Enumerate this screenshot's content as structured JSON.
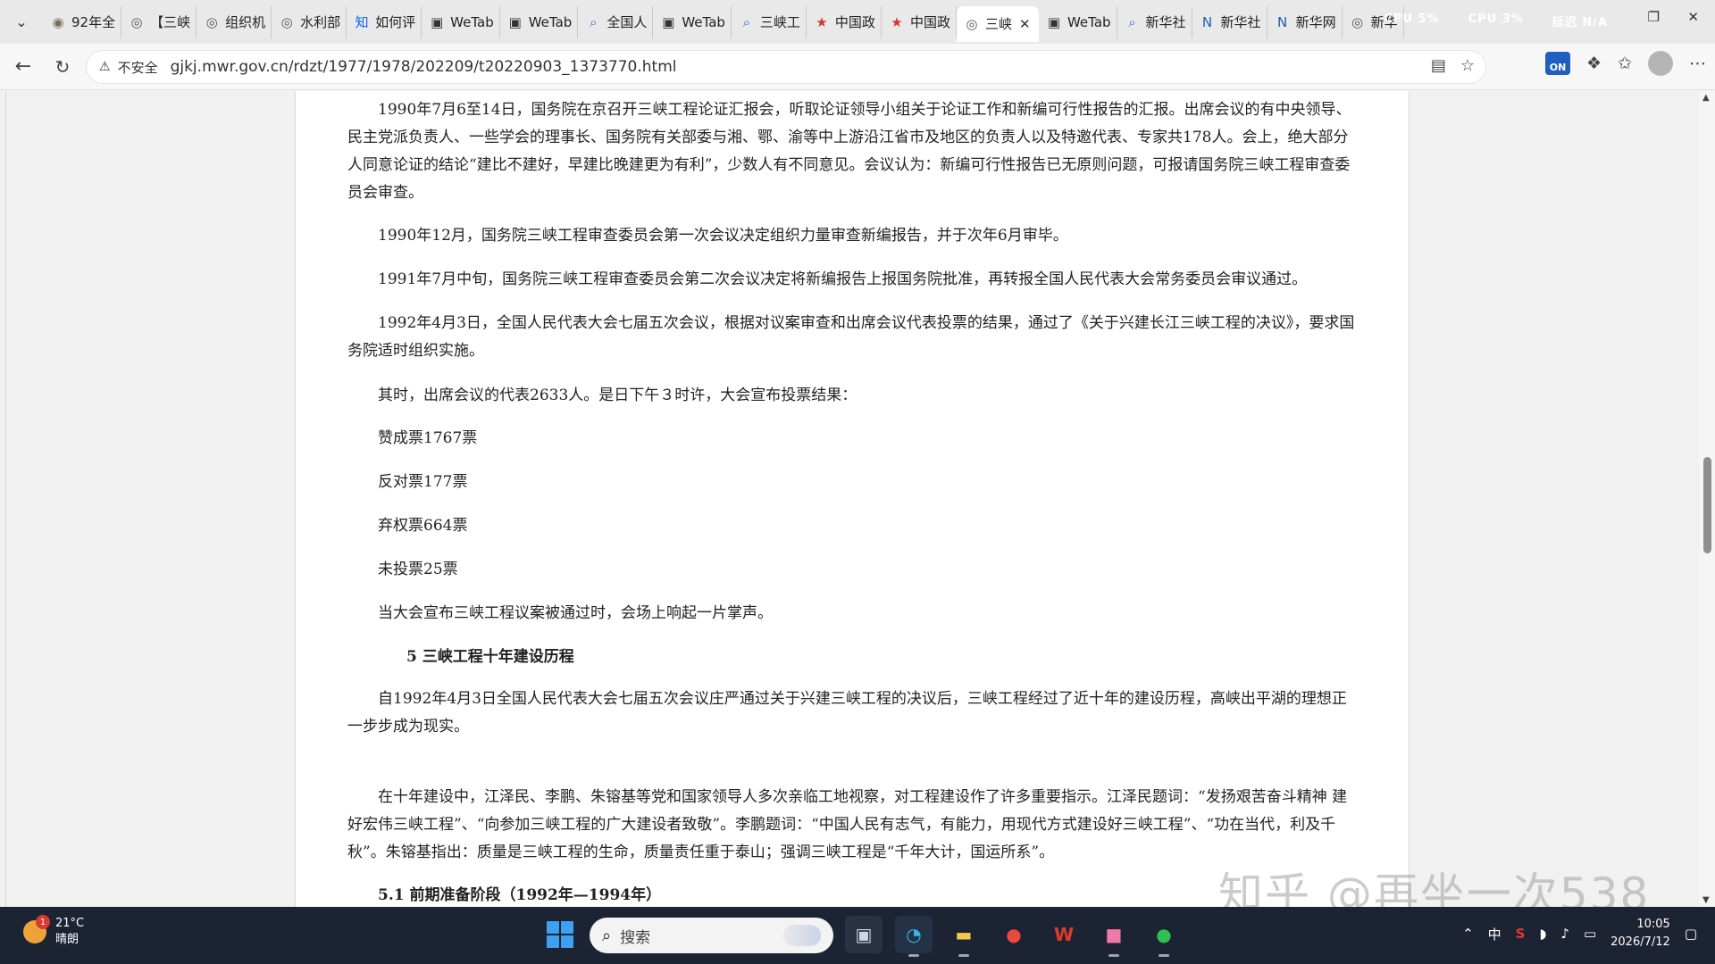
{
  "tabs": [
    {
      "label": "92年全",
      "icon": "avatar-icon",
      "color": "#7a6b5d"
    },
    {
      "label": "【三峡",
      "icon": "globe-icon",
      "color": "#555"
    },
    {
      "label": "组织机",
      "icon": "globe-icon",
      "color": "#555"
    },
    {
      "label": "水利部",
      "icon": "globe-icon",
      "color": "#555"
    },
    {
      "label": "如何评",
      "icon": "zhihu-icon",
      "color": "#0a66ff"
    },
    {
      "label": "WeTab",
      "icon": "wetab-icon",
      "color": "#333"
    },
    {
      "label": "WeTab",
      "icon": "wetab-icon",
      "color": "#333"
    },
    {
      "label": "全国人",
      "icon": "search-icon",
      "color": "#2b6fd6"
    },
    {
      "label": "WeTab",
      "icon": "wetab-icon",
      "color": "#333"
    },
    {
      "label": "三峡工",
      "icon": "search-icon",
      "color": "#2b6fd6"
    },
    {
      "label": "中国政",
      "icon": "emblem-icon",
      "color": "#d23a2f"
    },
    {
      "label": "中国政",
      "icon": "emblem-icon",
      "color": "#d23a2f"
    },
    {
      "label": "三峡",
      "icon": "globe-icon",
      "color": "#555",
      "active": true
    },
    {
      "label": "WeTab",
      "icon": "wetab-icon",
      "color": "#333"
    },
    {
      "label": "新华社",
      "icon": "search-icon",
      "color": "#2b6fd6"
    },
    {
      "label": "新华社",
      "icon": "news-icon",
      "color": "#1a5fb4"
    },
    {
      "label": "新华网",
      "icon": "news-icon",
      "color": "#1a5fb4"
    },
    {
      "label": "新华",
      "icon": "globe-icon",
      "color": "#555"
    }
  ],
  "system_monitor": {
    "cpu1": "CPU 5%",
    "cpu2": "CPU 3%",
    "net": "延迟 N/A",
    "extra": "N/A"
  },
  "address_bar": {
    "security_label": "不安全",
    "url": "gjkj.mwr.gov.cn/rdzt/1977/1978/202209/t20220903_1373770.html"
  },
  "extensions": {
    "on_badge": "ON"
  },
  "article": {
    "p1": "1990年7月6至14日，国务院在京召开三峡工程论证汇报会，听取论证领导小组关于论证工作和新编可行性报告的汇报。出席会议的有中央领导、民主党派负责人、一些学会的理事长、国务院有关部委与湘、鄂、渝等中上游沿江省市及地区的负责人以及特邀代表、专家共178人。会上，绝大部分人同意论证的结论“建比不建好，早建比晚建更为有利”，少数人有不同意见。会议认为：新编可行性报告已无原则问题，可报请国务院三峡工程审查委员会审查。",
    "p2": "1990年12月，国务院三峡工程审查委员会第一次会议决定组织力量审查新编报告，并于次年6月审毕。",
    "p3": "1991年7月中旬，国务院三峡工程审查委员会第二次会议决定将新编报告上报国务院批准，再转报全国人民代表大会常务委员会审议通过。",
    "p4": "1992年4月3日，全国人民代表大会七届五次会议，根据对议案审查和出席会议代表投票的结果，通过了《关于兴建长江三峡工程的决议》，要求国务院适时组织实施。",
    "p5": "其时，出席会议的代表2633人。是日下午３时许，大会宣布投票结果：",
    "p6": "赞成票1767票",
    "p7": "反对票177票",
    "p8": "弃权票664票",
    "p9": "未投票25票",
    "p10": "当大会宣布三峡工程议案被通过时，会场上响起一片掌声。",
    "h5": "5  三峡工程十年建设历程",
    "p11": "自1992年4月3日全国人民代表大会七届五次会议庄严通过关于兴建三峡工程的决议后，三峡工程经过了近十年的建设历程，高峡出平湖的理想正一步步成为现实。",
    "p12": "在十年建设中，江泽民、李鹏、朱镕基等党和国家领导人多次亲临工地视察，对工程建设作了许多重要指示。江泽民题词：“发扬艰苦奋斗精神  建好宏伟三峡工程”、“向参加三峡工程的广大建设者致敬”。李鹏题词：“中国人民有志气，有能力，用现代方式建设好三峡工程”、“功在当代，利及千秋”。朱镕基指出：质量是三峡工程的生命，质量责任重于泰山；强调三峡工程是“千年大计，国运所系”。",
    "h51": "5.1  前期准备阶段（1992年—1994年）"
  },
  "watermark": "知乎 @再坐一次538",
  "taskbar": {
    "weather_badge": "1",
    "temperature": "21°C",
    "condition": "晴朗",
    "search_placeholder": "搜索",
    "ime": "中",
    "time": "10:05",
    "date": "2026/7/12"
  }
}
